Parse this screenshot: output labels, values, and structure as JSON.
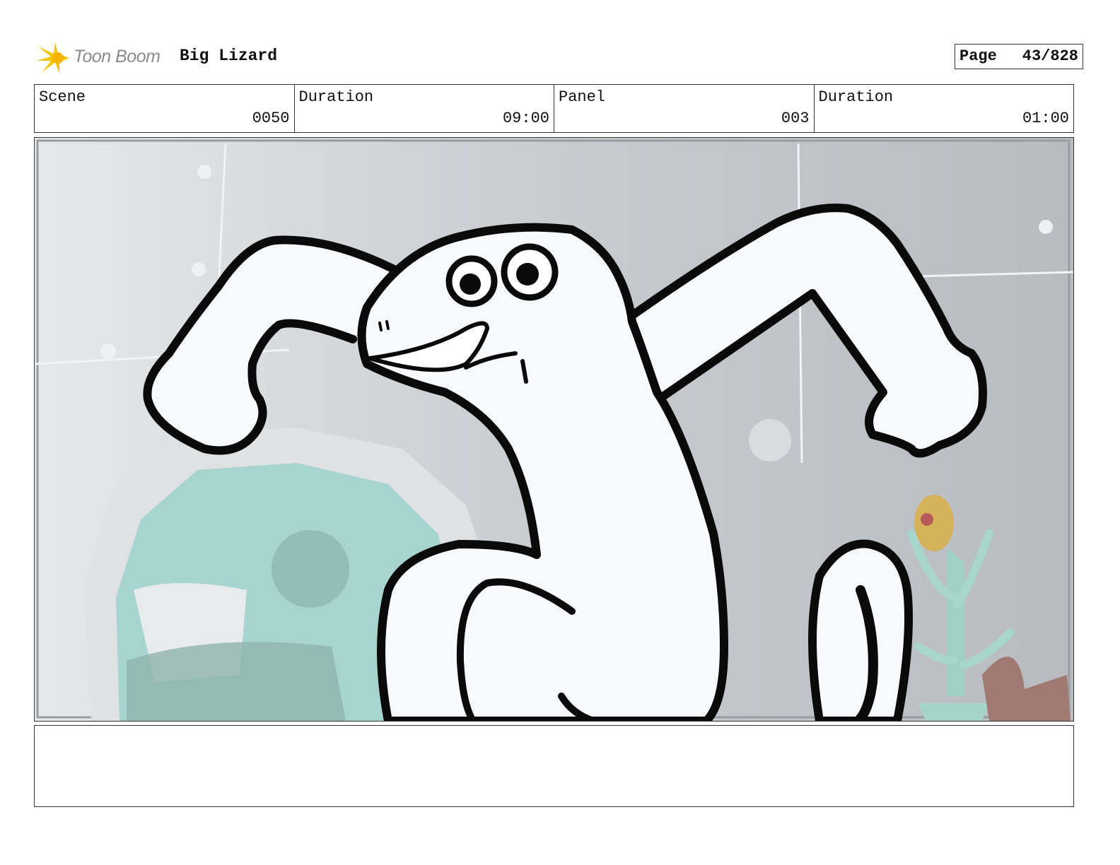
{
  "header": {
    "logo_text": "Toon Boom",
    "project_title": "Big Lizard",
    "page_label": "Page",
    "page_number": "43/828"
  },
  "info": {
    "scene_label": "Scene",
    "scene_value": "0050",
    "scene_duration_label": "Duration",
    "scene_duration_value": "09:00",
    "panel_label": "Panel",
    "panel_value": "003",
    "panel_duration_label": "Duration",
    "panel_duration_value": "01:00"
  },
  "panel_image": {
    "description_icon": "storyboard-drawing",
    "colors": {
      "wall": "#c9ccd0",
      "window": "#a8d4d0",
      "character_fill": "#f7f9fc",
      "outline": "#0a0a0a",
      "logo_yellow": "#f5c400"
    }
  },
  "notes": {
    "text": ""
  }
}
